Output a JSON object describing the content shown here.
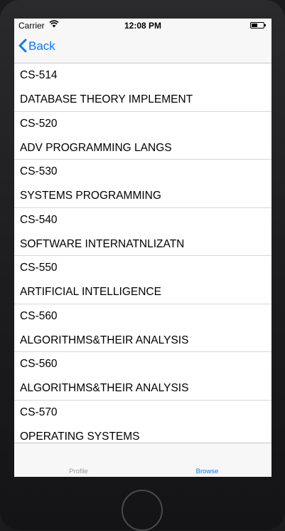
{
  "status_bar": {
    "carrier": "Carrier",
    "time": "12:08 PM"
  },
  "nav": {
    "back_label": "Back"
  },
  "courses": [
    {
      "code": "CS-514",
      "name": "DATABASE THEORY IMPLEMENT"
    },
    {
      "code": "CS-520",
      "name": "ADV PROGRAMMING LANGS"
    },
    {
      "code": "CS-530",
      "name": "SYSTEMS PROGRAMMING"
    },
    {
      "code": "CS-540",
      "name": "SOFTWARE INTERNATNLIZATN"
    },
    {
      "code": "CS-550",
      "name": "ARTIFICIAL INTELLIGENCE"
    },
    {
      "code": "CS-560",
      "name": "ALGORITHMS&THEIR ANALYSIS"
    },
    {
      "code": "CS-560",
      "name": "ALGORITHMS&THEIR ANALYSIS"
    },
    {
      "code": "CS-570",
      "name": "OPERATING SYSTEMS"
    }
  ],
  "tabs": [
    {
      "label": "Profile",
      "selected": false
    },
    {
      "label": "Browse",
      "selected": true
    }
  ],
  "colors": {
    "accent": "#0a7aff",
    "tab_inactive": "#9a9a9a",
    "bar_background": "#f7f7f7"
  }
}
